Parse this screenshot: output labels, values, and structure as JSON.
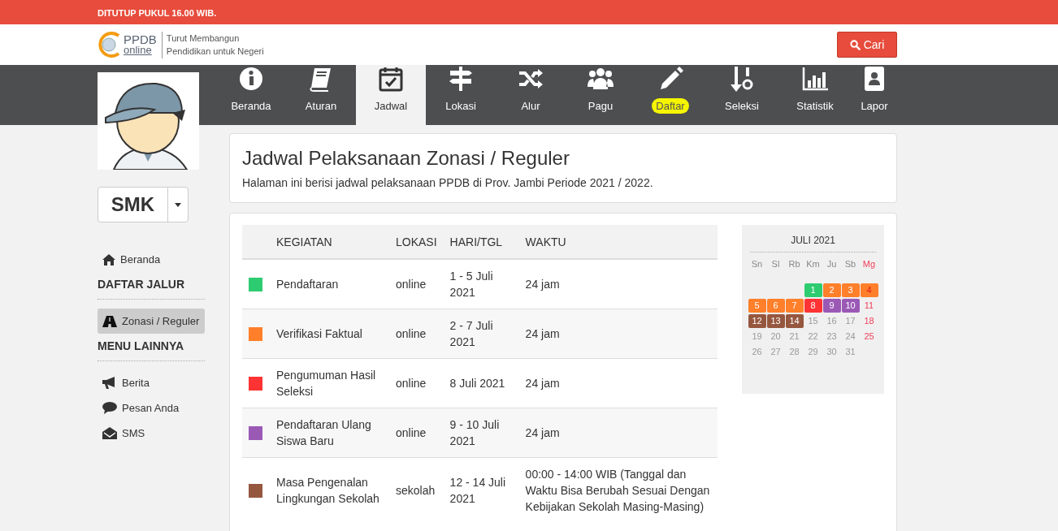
{
  "notice": "DITUTUP PUKUL 16.00 WIB.",
  "logo": {
    "top": "PPDB",
    "bottom": "online",
    "tagline_1": "Turut Membangun",
    "tagline_2": "Pendidikan untuk Negeri"
  },
  "search_button": "Cari",
  "nav": [
    {
      "label": "Beranda",
      "selected": false,
      "highlighted": false
    },
    {
      "label": "Aturan",
      "selected": false,
      "highlighted": false
    },
    {
      "label": "Jadwal",
      "selected": true,
      "highlighted": false
    },
    {
      "label": "Lokasi",
      "selected": false,
      "highlighted": false
    },
    {
      "label": "Alur",
      "selected": false,
      "highlighted": false
    },
    {
      "label": "Pagu",
      "selected": false,
      "highlighted": false
    },
    {
      "label": "Daftar",
      "selected": false,
      "highlighted": true
    },
    {
      "label": "Seleksi",
      "selected": false,
      "highlighted": false
    },
    {
      "label": "Statistik",
      "selected": false,
      "highlighted": false
    },
    {
      "label": "Lapor",
      "selected": false,
      "highlighted": false
    }
  ],
  "sidebar": {
    "level": "SMK",
    "home": {
      "label": "Beranda",
      "selected": false
    },
    "sections": [
      {
        "title": "DAFTAR JALUR",
        "items": [
          {
            "label": "Zonasi / Reguler",
            "selected": true
          }
        ]
      },
      {
        "title": "MENU LAINNYA",
        "items": [
          {
            "label": "Berita",
            "selected": false
          },
          {
            "label": "Pesan Anda",
            "selected": false
          },
          {
            "label": "SMS",
            "selected": false
          }
        ]
      }
    ]
  },
  "page": {
    "title": "Jadwal Pelaksanaan Zonasi / Reguler",
    "subtitle": "Halaman ini berisi jadwal pelaksanaan PPDB di Prov. Jambi Periode 2021 / 2022."
  },
  "table": {
    "columns": [
      "KEGIATAN",
      "LOKASI",
      "HARI/TGL",
      "WAKTU"
    ],
    "rows": [
      {
        "color": "#2ecc71",
        "cells": [
          "Pendaftaran",
          "online",
          "1 - 5 Juli 2021",
          "24 jam"
        ]
      },
      {
        "color": "#ff7f2a",
        "cells": [
          "Verifikasi Faktual",
          "online",
          "2 - 7 Juli 2021",
          "24 jam"
        ]
      },
      {
        "color": "#ff3333",
        "cells": [
          "Pengumuman Hasil Seleksi",
          "online",
          "8 Juli 2021",
          "24 jam"
        ]
      },
      {
        "color": "#9b59b6",
        "cells": [
          "Pendaftaran Ulang Siswa Baru",
          "online",
          "9 - 10 Juli 2021",
          "24 jam"
        ]
      },
      {
        "color": "#96573f",
        "cells": [
          "Masa Pengenalan Lingkungan Sekolah",
          "sekolah",
          "12 - 14 Juli 2021",
          "00:00 - 14:00 WIB (Tanggal dan Waktu Bisa Berubah Sesuai Dengan Kebijakan Sekolah Masing-Masing)"
        ]
      }
    ]
  },
  "calendar": {
    "title": "JULI 2021",
    "weekdays": [
      {
        "label": "Sn",
        "holiday": false
      },
      {
        "label": "Sl",
        "holiday": false
      },
      {
        "label": "Rb",
        "holiday": false
      },
      {
        "label": "Km",
        "holiday": false
      },
      {
        "label": "Ju",
        "holiday": false
      },
      {
        "label": "Sb",
        "holiday": false
      },
      {
        "label": "Mg",
        "holiday": true
      }
    ],
    "days": [
      {
        "day": "1",
        "color": "#2ecc71",
        "holiday": false
      },
      {
        "day": "2",
        "color": "#ff7f2a",
        "holiday": false
      },
      {
        "day": "3",
        "color": "#ff7f2a",
        "holiday": false
      },
      {
        "day": "4",
        "color": "#ff7f2a",
        "holiday": true
      },
      {
        "day": "5",
        "color": "#ff7f2a",
        "holiday": false
      },
      {
        "day": "6",
        "color": "#ff7f2a",
        "holiday": false
      },
      {
        "day": "7",
        "color": "#ff7f2a",
        "holiday": false
      },
      {
        "day": "8",
        "color": "#ff3333",
        "holiday": false
      },
      {
        "day": "9",
        "color": "#9b59b6",
        "holiday": false
      },
      {
        "day": "10",
        "color": "#9b59b6",
        "holiday": false
      },
      {
        "day": "11",
        "holiday": true
      },
      {
        "day": "12",
        "color": "#96573f",
        "holiday": false
      },
      {
        "day": "13",
        "color": "#96573f",
        "holiday": false
      },
      {
        "day": "14",
        "color": "#96573f",
        "holiday": false
      },
      {
        "day": "15",
        "holiday": false
      },
      {
        "day": "16",
        "holiday": false
      },
      {
        "day": "17",
        "holiday": false
      },
      {
        "day": "18",
        "holiday": true
      },
      {
        "day": "19",
        "holiday": false
      },
      {
        "day": "20",
        "holiday": false
      },
      {
        "day": "21",
        "holiday": false
      },
      {
        "day": "22",
        "holiday": false
      },
      {
        "day": "23",
        "holiday": false
      },
      {
        "day": "24",
        "holiday": false
      },
      {
        "day": "25",
        "holiday": true
      },
      {
        "day": "26",
        "holiday": false
      },
      {
        "day": "27",
        "holiday": false
      },
      {
        "day": "28",
        "holiday": false
      },
      {
        "day": "29",
        "holiday": false
      },
      {
        "day": "30",
        "holiday": false
      },
      {
        "day": "31",
        "holiday": false
      }
    ]
  }
}
